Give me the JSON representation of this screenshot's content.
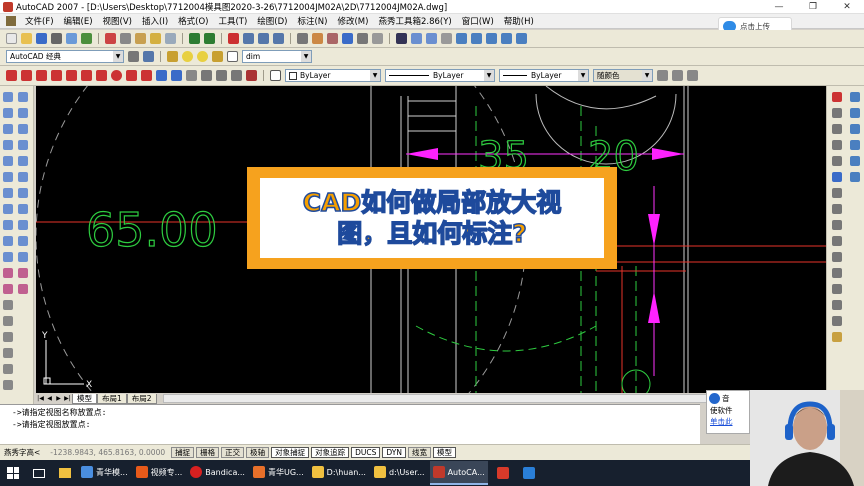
{
  "window": {
    "title": "AutoCAD 2007 - [D:\\Users\\Desktop\\7712004模具图2020-3-26\\7712004JM02A\\2D\\7712004JM02A.dwg]",
    "controls": [
      "—",
      "❐",
      "✕"
    ]
  },
  "menu": {
    "items": [
      "文件(F)",
      "编辑(E)",
      "视图(V)",
      "插入(I)",
      "格式(O)",
      "工具(T)",
      "绘图(D)",
      "标注(N)",
      "修改(M)",
      "燕秀工具箱2.86(Y)",
      "窗口(W)",
      "帮助(H)"
    ]
  },
  "cloud": {
    "label": "点击上传"
  },
  "toolbar2": {
    "workspace": "AutoCAD 经典",
    "textstyle": "dim"
  },
  "toolbar3": {
    "layer": "ByLayer",
    "linetype": "ByLayer",
    "lineweight": "ByLayer",
    "plotstyle": "随颜色"
  },
  "drawing": {
    "dim_large": "65.00",
    "dim_top": "35",
    "dim_top2": "20",
    "ucs_x": "X",
    "ucs_y": "Y"
  },
  "title_card": {
    "line1": "CAD如何做局部放大视",
    "line2": "图，且如何标注?"
  },
  "layout_tabs": [
    "模型",
    "布局1",
    "布局2"
  ],
  "command": {
    "line1": "->请指定视图名称放置点:",
    "line2": "->请指定视图放置点:"
  },
  "status": {
    "label": "燕秀字高<",
    "coords": "-1238.9843, 465.8163, 0.0000",
    "buttons": [
      "捕捉",
      "栅格",
      "正交",
      "极轴",
      "对象捕捉",
      "对象追踪",
      "DUCS",
      "DYN",
      "线宽",
      "模型"
    ],
    "active": [
      "对象捕捉",
      "对象追踪",
      "DUCS",
      "DYN",
      "模型"
    ]
  },
  "notification": {
    "title": "音",
    "line1": "使软件",
    "link": "单击此"
  },
  "taskbar": {
    "items": [
      "青华模...",
      "视频专...",
      "Bandica...",
      "青华UG...",
      "D:\\huan...",
      "d:\\User...",
      "AutoCA..."
    ]
  }
}
